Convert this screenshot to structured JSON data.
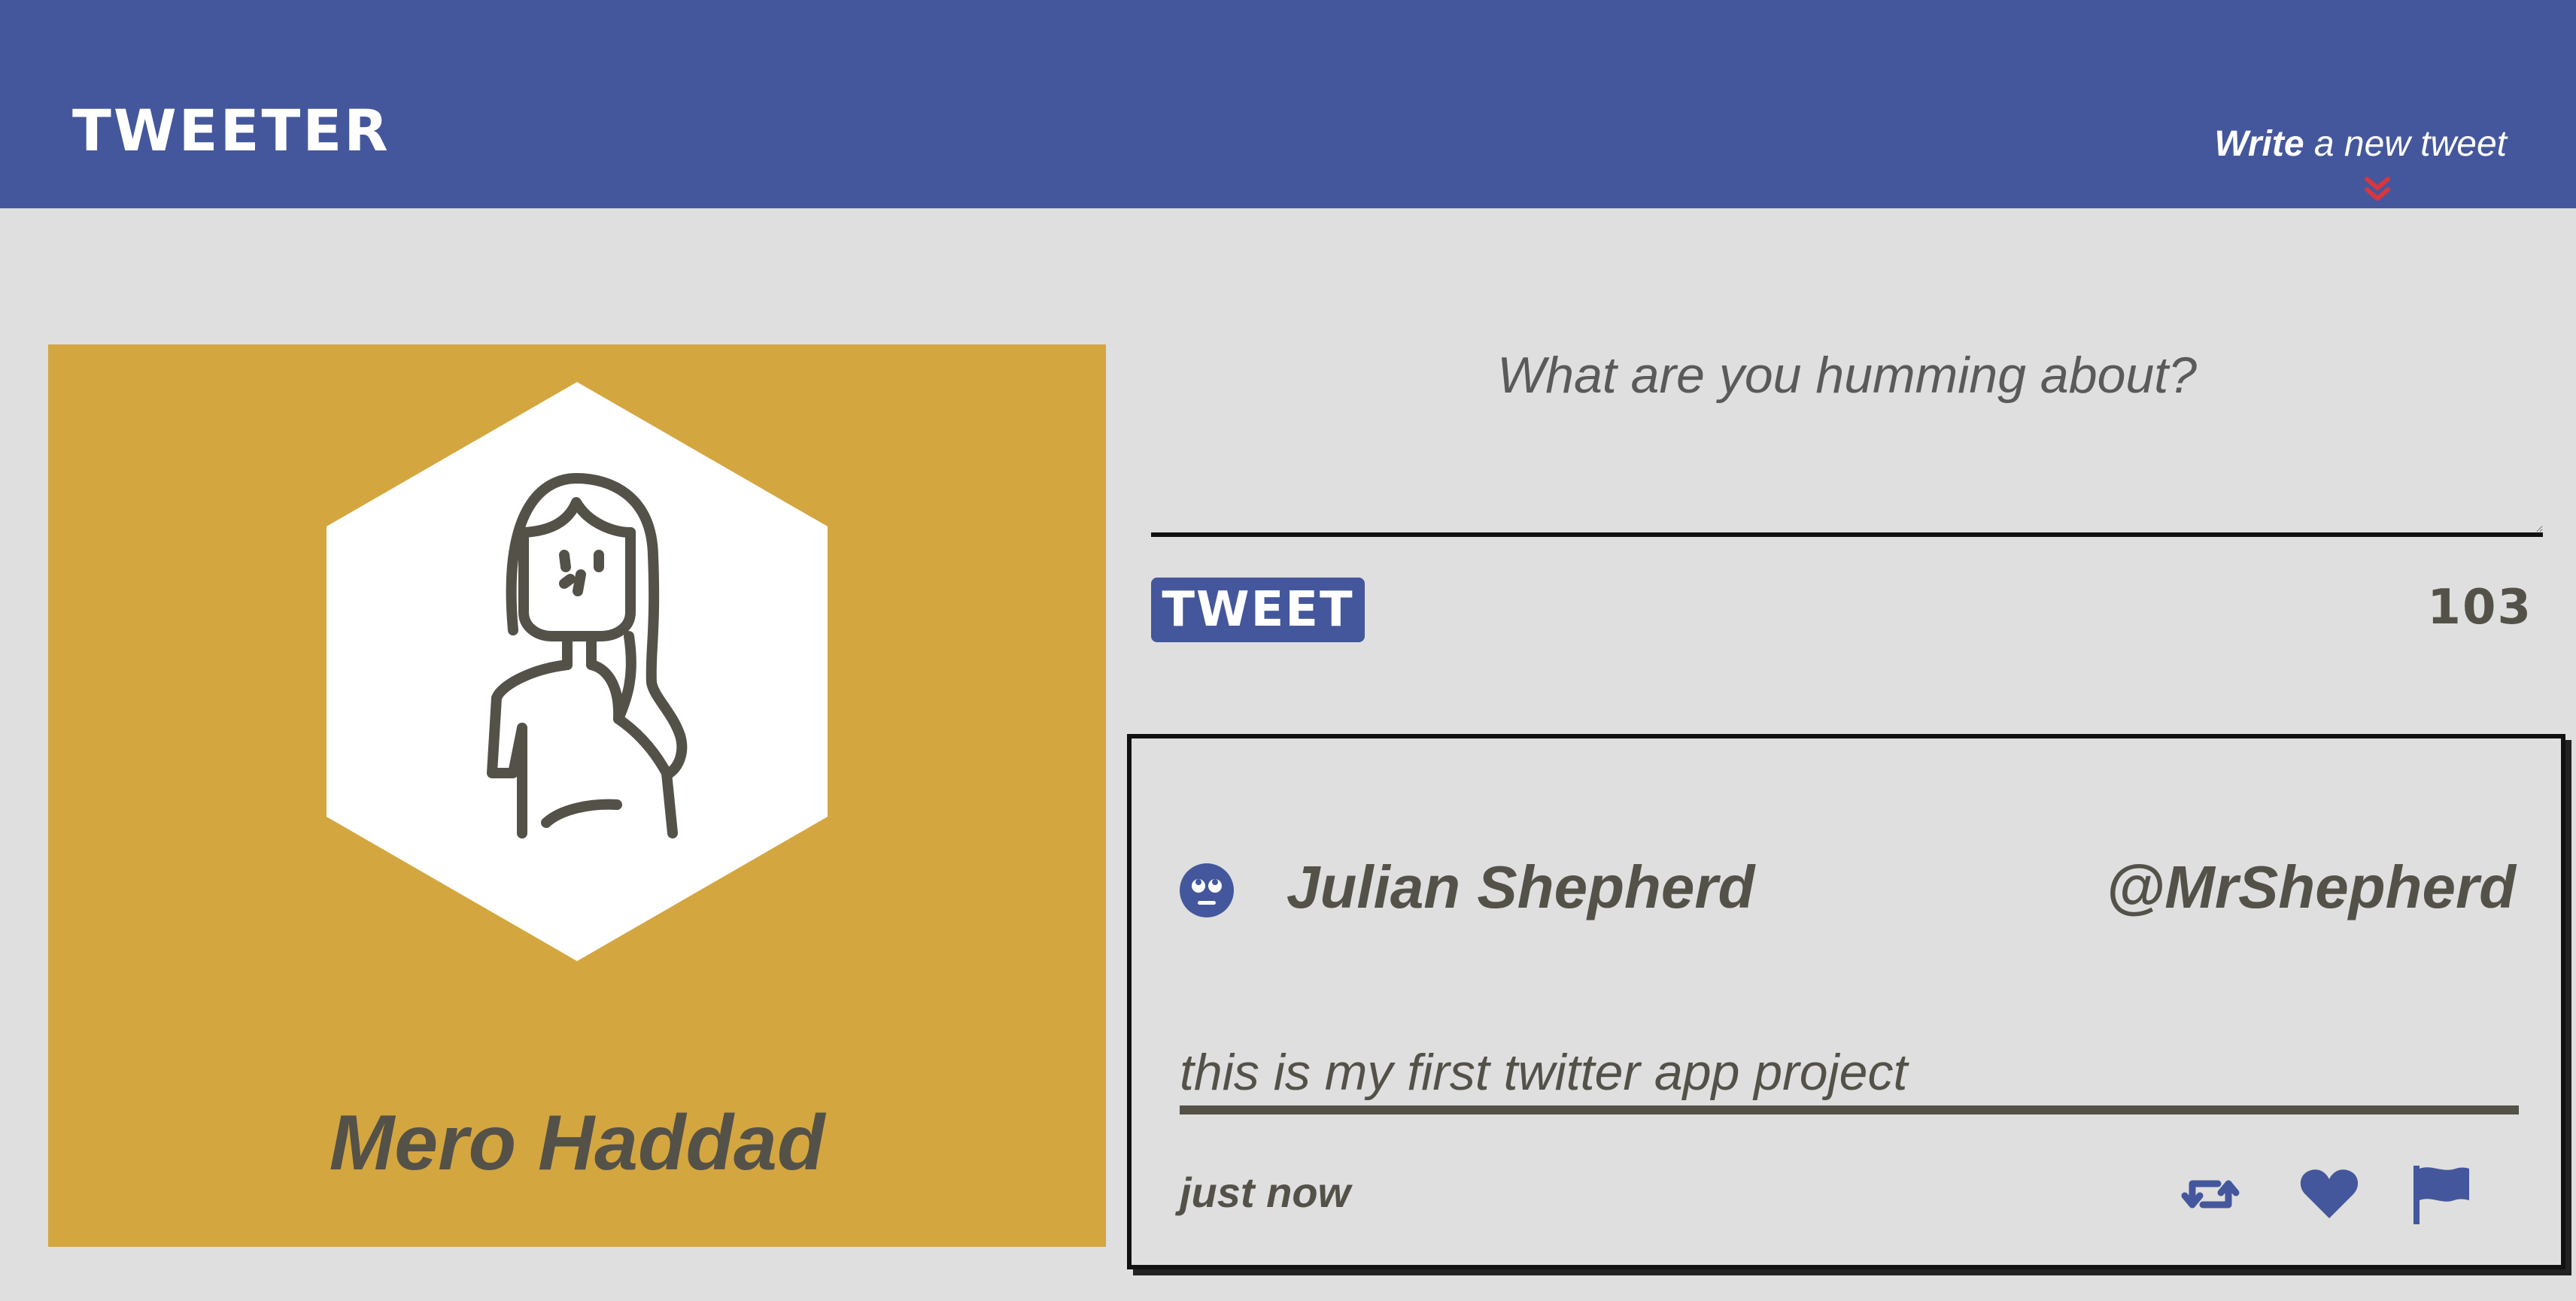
{
  "header": {
    "logo": "TWEETER",
    "write_strong": "Write",
    "write_rest": " a new tweet",
    "icons": {
      "chevron": "chevrons-down-icon"
    },
    "colors": {
      "bar": "#44579c",
      "chevron": "#d9363e"
    }
  },
  "profile": {
    "name": "Mero Haddad",
    "avatar_icon": "woman-avatar-icon",
    "colors": {
      "card": "#d4a640",
      "hexagon": "#ffffff"
    }
  },
  "compose": {
    "placeholder": "What are you humming about?",
    "value": "",
    "tweet_button": "TWEET",
    "char_count": "103"
  },
  "tweet": {
    "name": "Julian Shepherd",
    "handle": "@MrShepherd",
    "text": "this is my first twitter app project",
    "time": "just now",
    "icons": {
      "avatar": "rolling-eyes-face-icon",
      "retweet": "retweet-icon",
      "like": "heart-icon",
      "flag": "flag-icon"
    },
    "colors": {
      "accent": "#44579c",
      "text": "#545149"
    }
  }
}
